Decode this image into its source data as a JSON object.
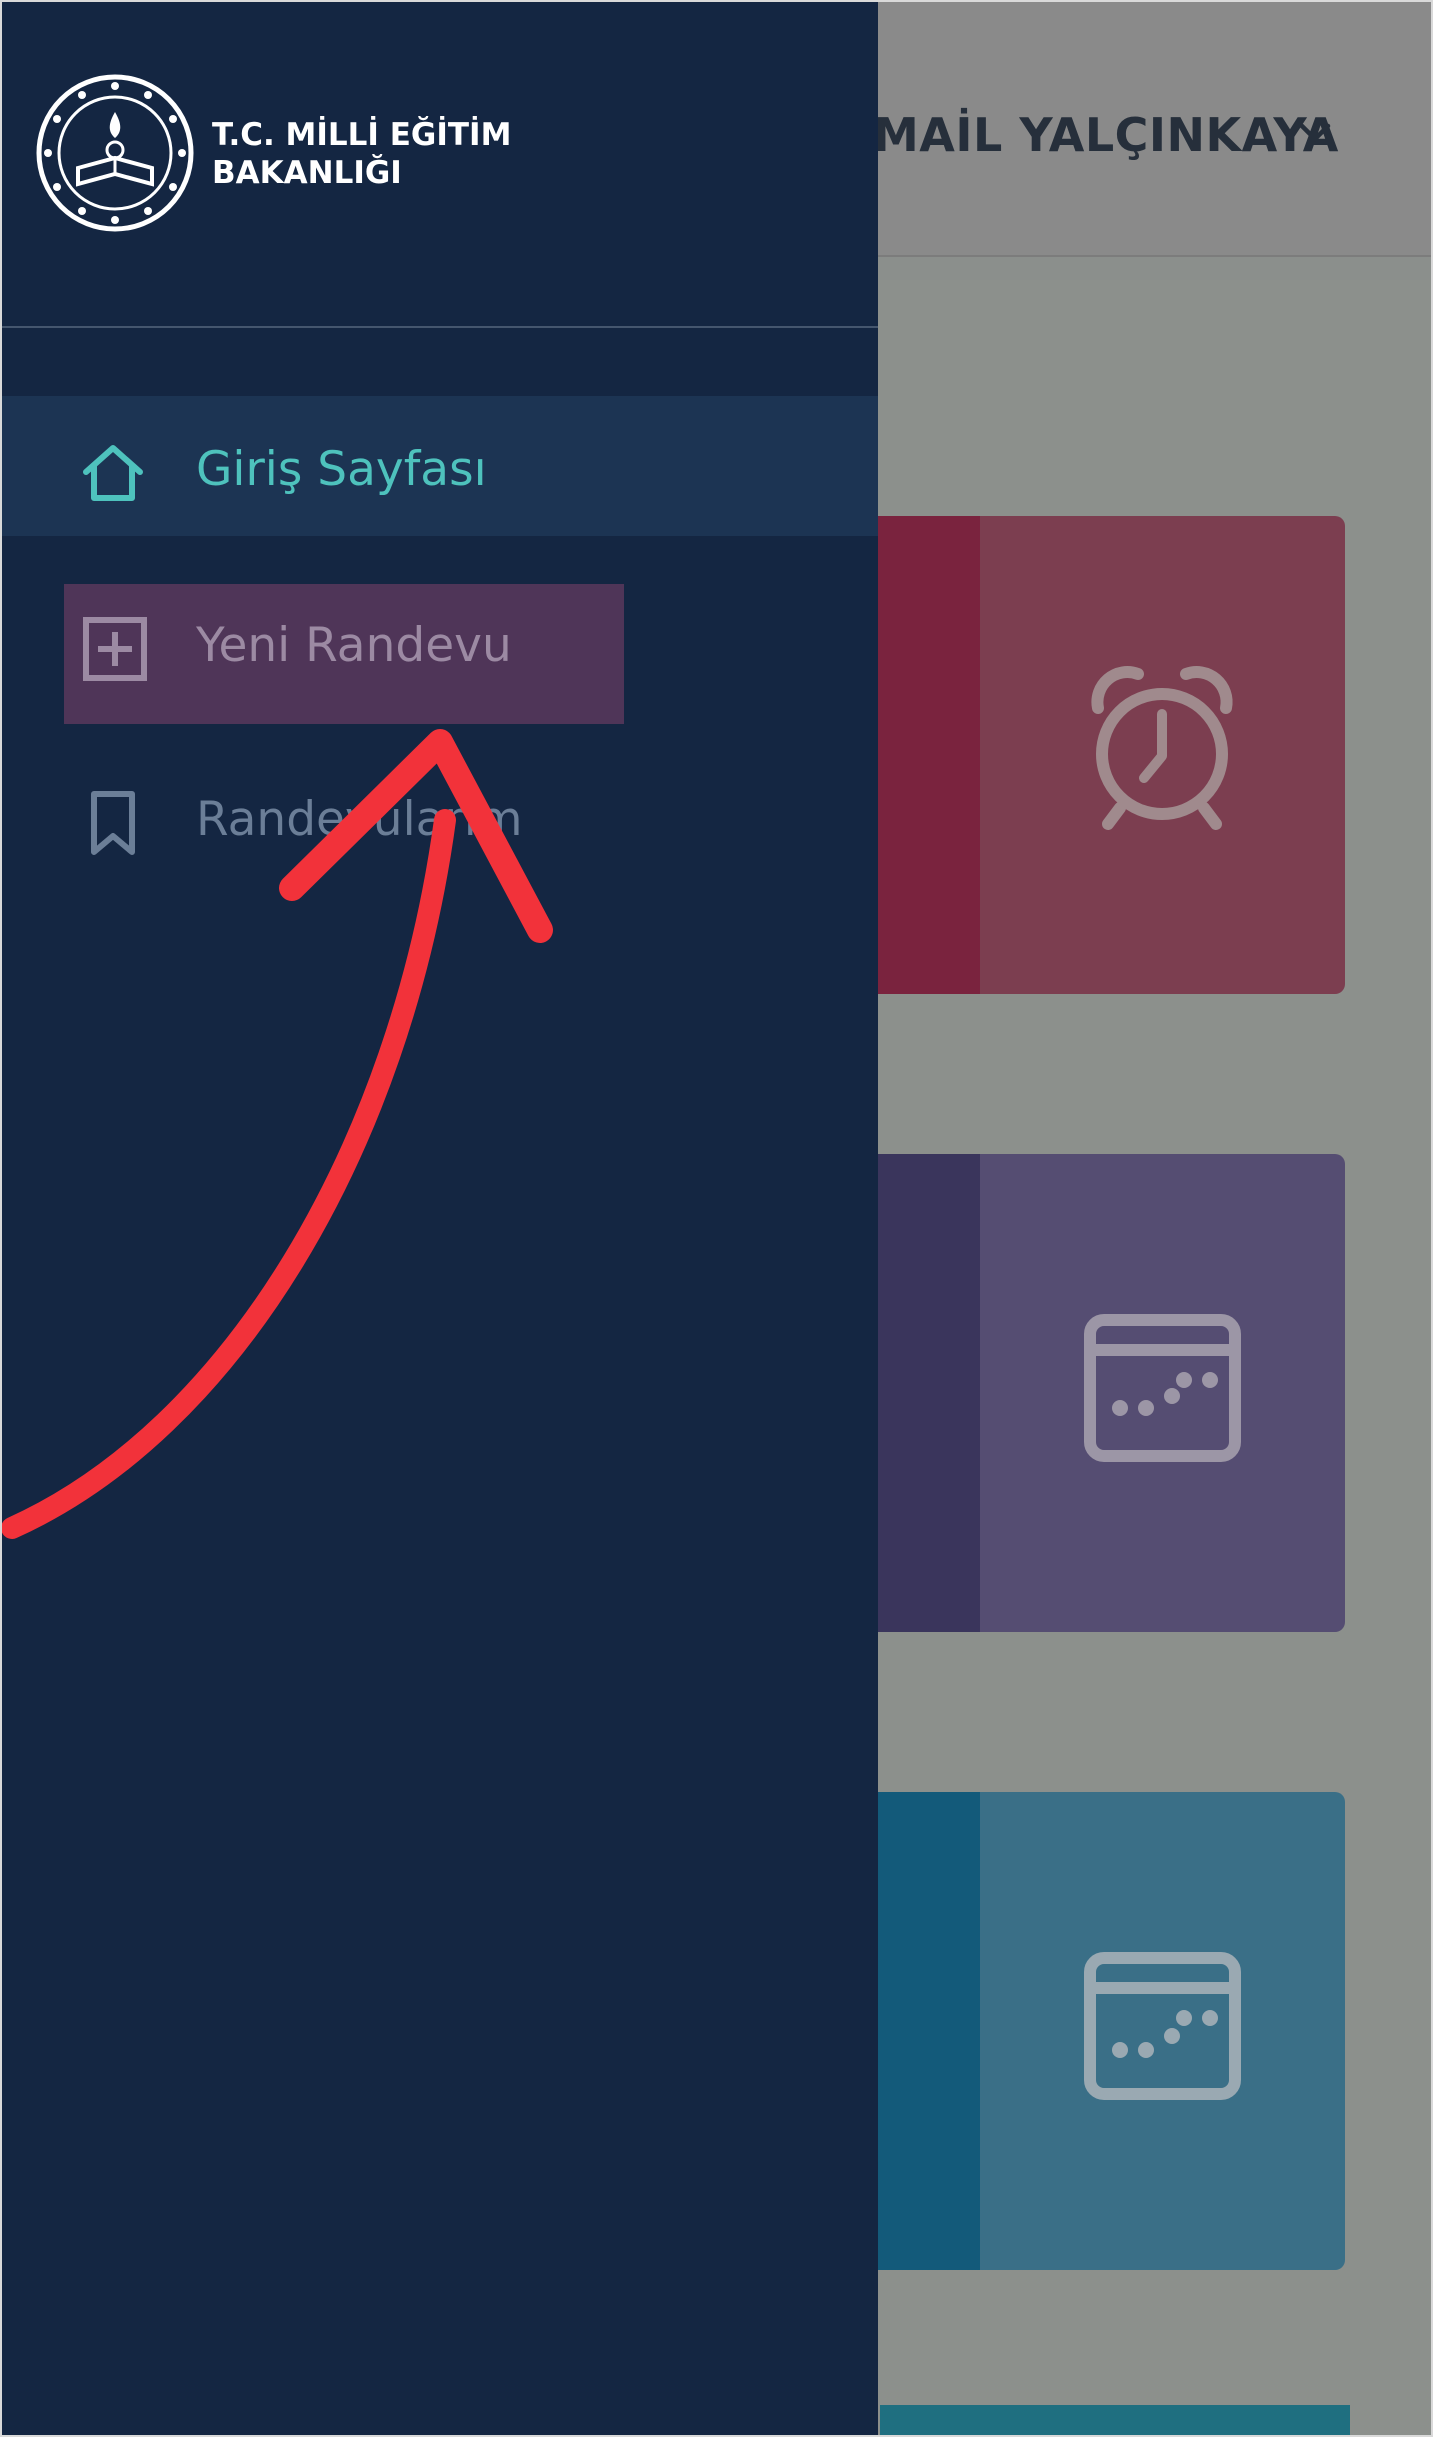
{
  "header": {
    "user_name_visible": "MAİL YALÇINKAYA",
    "user_menu_icon": "chevron-down-icon"
  },
  "drawer": {
    "logo": {
      "icon": "meb-seal-icon",
      "line1": "T.C. MİLLİ EĞİTİM",
      "line2": "BAKANLIĞI"
    },
    "items": [
      {
        "label": "Giriş Sayfası",
        "icon": "home-icon",
        "state": "active"
      },
      {
        "label": "Yeni Randevu",
        "icon": "plus-square-icon",
        "state": "highlighted"
      },
      {
        "label": "Randevularım",
        "icon": "bookmark-icon",
        "state": "default"
      }
    ]
  },
  "cards": [
    {
      "icon": "alarm-clock-icon",
      "color": "#7a233e"
    },
    {
      "icon": "calendar-icon",
      "color": "#3a355c"
    },
    {
      "icon": "calendar-icon",
      "color": "#135a7a"
    }
  ],
  "colors": {
    "drawer_bg": "#142642",
    "accent_teal": "#4ec2bd",
    "highlight": "#4f3558",
    "annotation_red": "#f2323a"
  },
  "annotation": {
    "icon": "red-arrow-annotation",
    "points_to": "Yeni Randevu"
  }
}
